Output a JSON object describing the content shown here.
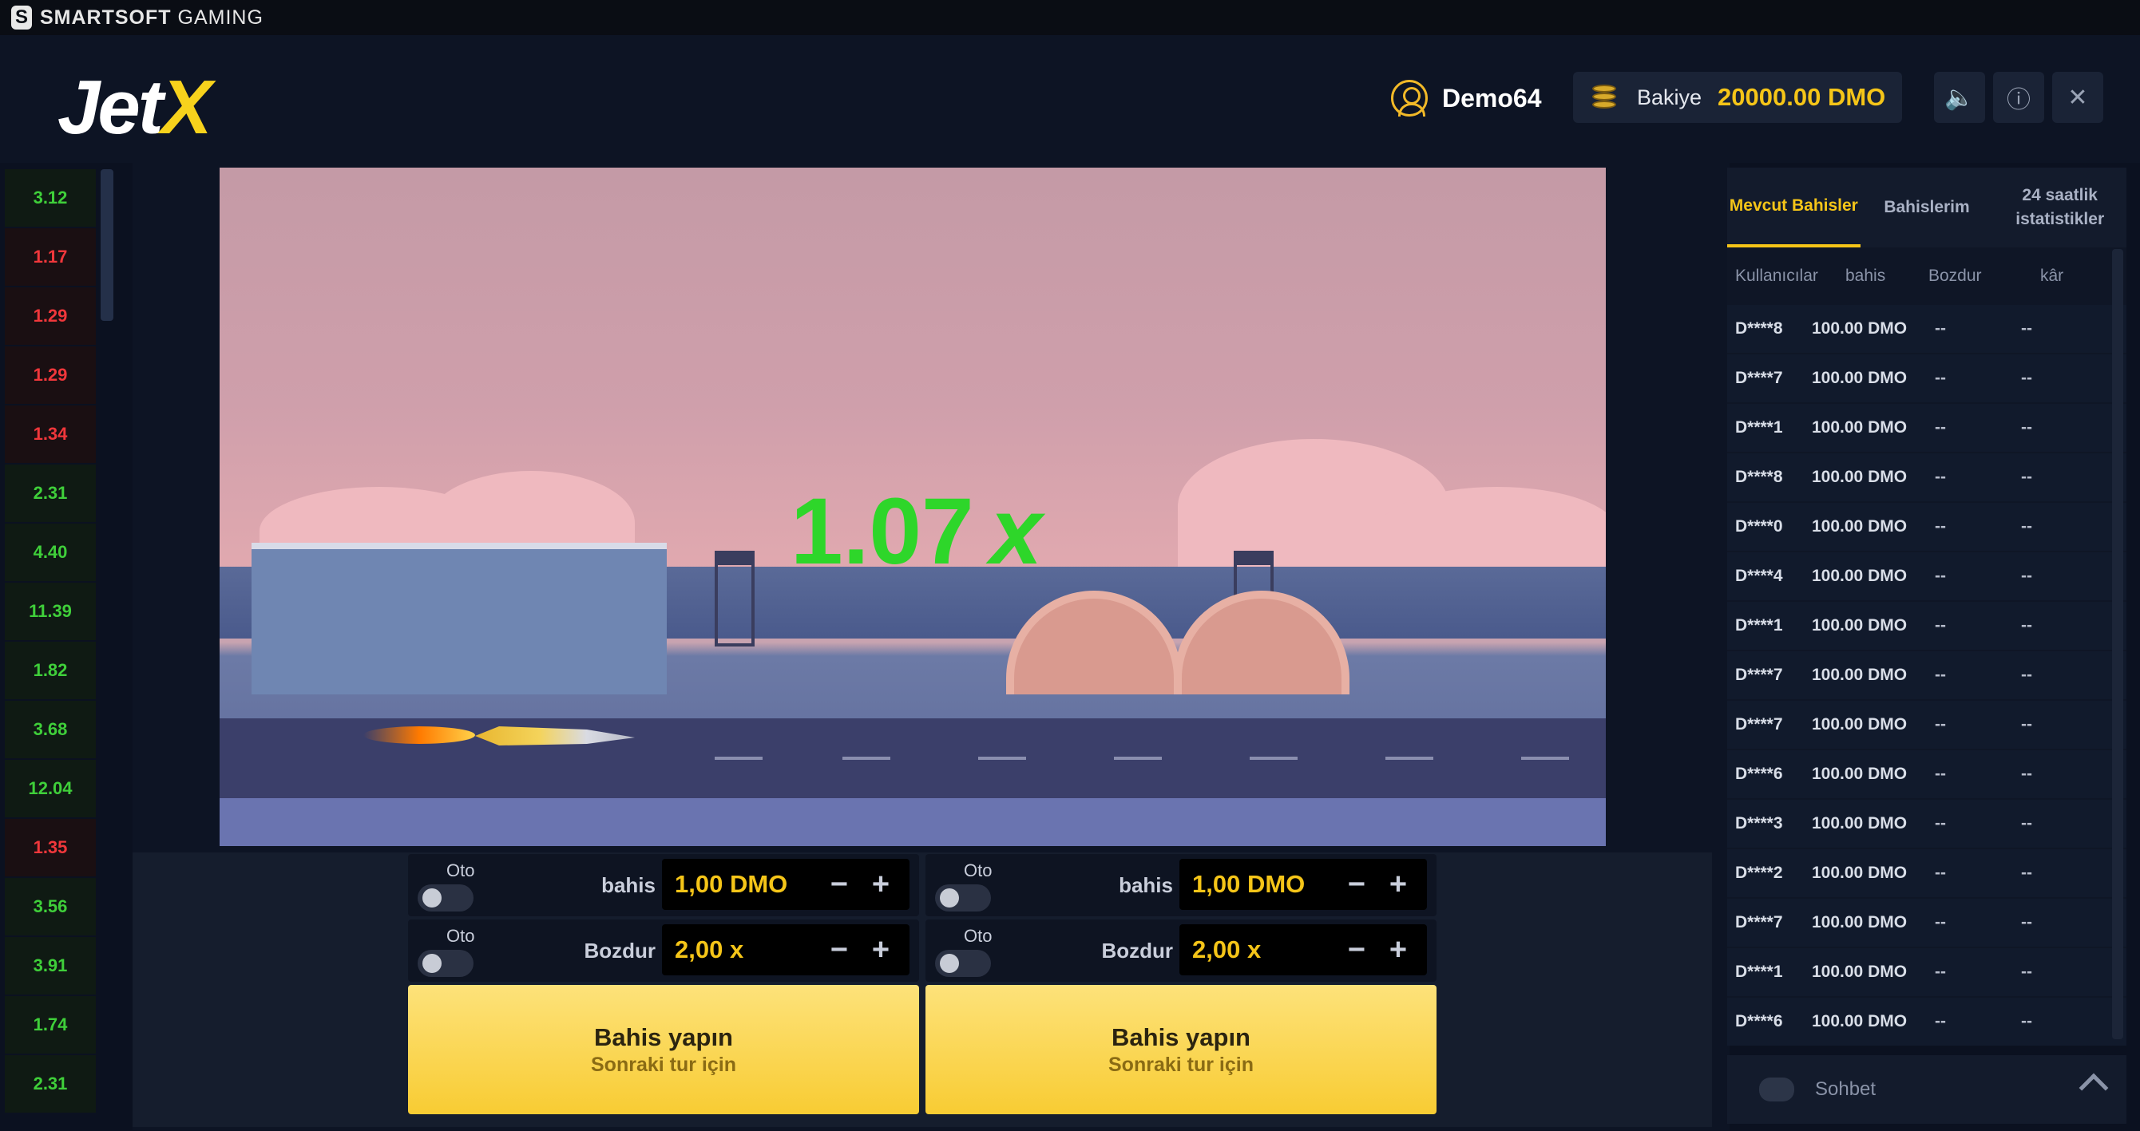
{
  "brand": {
    "bold": "SMARTSOFT",
    "light": "GAMING"
  },
  "header": {
    "logo_main": "Jet",
    "logo_accent": "X",
    "username": "Demo64",
    "balance_label": "Bakiye",
    "balance_value": "20000.00 DMO"
  },
  "history": [
    {
      "v": "3.12",
      "s": "win"
    },
    {
      "v": "1.17",
      "s": "lose"
    },
    {
      "v": "1.29",
      "s": "lose"
    },
    {
      "v": "1.29",
      "s": "lose"
    },
    {
      "v": "1.34",
      "s": "lose"
    },
    {
      "v": "2.31",
      "s": "win"
    },
    {
      "v": "4.40",
      "s": "win"
    },
    {
      "v": "11.39",
      "s": "win"
    },
    {
      "v": "1.82",
      "s": "win"
    },
    {
      "v": "3.68",
      "s": "win"
    },
    {
      "v": "12.04",
      "s": "win"
    },
    {
      "v": "1.35",
      "s": "lose"
    },
    {
      "v": "3.56",
      "s": "win"
    },
    {
      "v": "3.91",
      "s": "win"
    },
    {
      "v": "1.74",
      "s": "win"
    },
    {
      "v": "2.31",
      "s": "win"
    }
  ],
  "game": {
    "multiplier": "1.07",
    "multiplier_suffix": "x"
  },
  "bets": [
    {
      "oto_label": "Oto",
      "bahis_label": "bahis",
      "bahis_value": "1,00 DMO",
      "oto2_label": "Oto",
      "bozdur_label": "Bozdur",
      "bozdur_value": "2,00 x",
      "button_main": "Bahis yapın",
      "button_sub": "Sonraki tur için"
    },
    {
      "oto_label": "Oto",
      "bahis_label": "bahis",
      "bahis_value": "1,00 DMO",
      "oto2_label": "Oto",
      "bozdur_label": "Bozdur",
      "bozdur_value": "2,00 x",
      "button_main": "Bahis yapın",
      "button_sub": "Sonraki tur için"
    }
  ],
  "right_panel": {
    "tabs": [
      "Mevcut Bahisler",
      "Bahislerim",
      "24 saatlik istatistikler"
    ],
    "columns": [
      "Kullanıcılar",
      "bahis",
      "Bozdur",
      "kâr"
    ],
    "rows": [
      {
        "user": "D****8",
        "bet": "100.00 DMO",
        "boz": "--",
        "kar": "--"
      },
      {
        "user": "D****7",
        "bet": "100.00 DMO",
        "boz": "--",
        "kar": "--"
      },
      {
        "user": "D****1",
        "bet": "100.00 DMO",
        "boz": "--",
        "kar": "--"
      },
      {
        "user": "D****8",
        "bet": "100.00 DMO",
        "boz": "--",
        "kar": "--"
      },
      {
        "user": "D****0",
        "bet": "100.00 DMO",
        "boz": "--",
        "kar": "--"
      },
      {
        "user": "D****4",
        "bet": "100.00 DMO",
        "boz": "--",
        "kar": "--"
      },
      {
        "user": "D****1",
        "bet": "100.00 DMO",
        "boz": "--",
        "kar": "--"
      },
      {
        "user": "D****7",
        "bet": "100.00 DMO",
        "boz": "--",
        "kar": "--"
      },
      {
        "user": "D****7",
        "bet": "100.00 DMO",
        "boz": "--",
        "kar": "--"
      },
      {
        "user": "D****6",
        "bet": "100.00 DMO",
        "boz": "--",
        "kar": "--"
      },
      {
        "user": "D****3",
        "bet": "100.00 DMO",
        "boz": "--",
        "kar": "--"
      },
      {
        "user": "D****2",
        "bet": "100.00 DMO",
        "boz": "--",
        "kar": "--"
      },
      {
        "user": "D****7",
        "bet": "100.00 DMO",
        "boz": "--",
        "kar": "--"
      },
      {
        "user": "D****1",
        "bet": "100.00 DMO",
        "boz": "--",
        "kar": "--"
      },
      {
        "user": "D****6",
        "bet": "100.00 DMO",
        "boz": "--",
        "kar": "--"
      }
    ],
    "chat_label": "Sohbet"
  },
  "colors": {
    "accent": "#f5c518",
    "win": "#3fcf3a",
    "lose": "#f0373b",
    "multiplier": "#2ed62a"
  }
}
